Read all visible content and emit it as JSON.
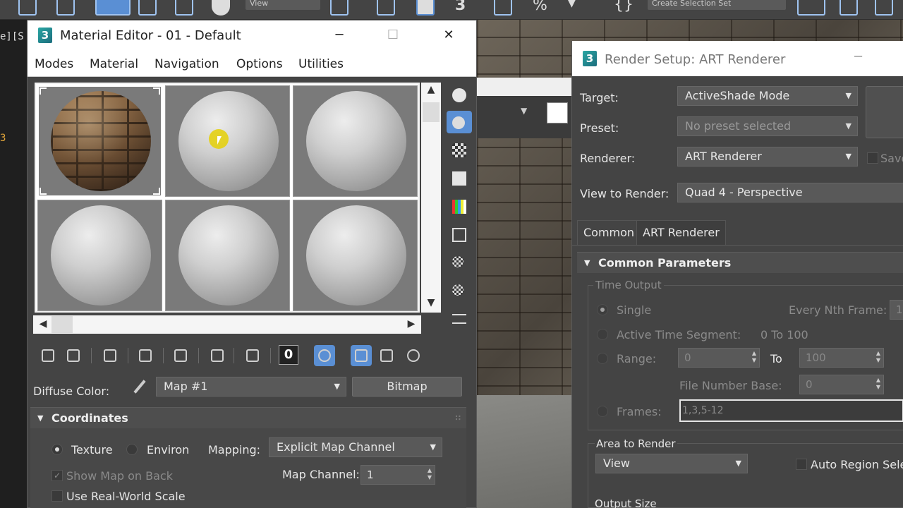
{
  "background": {
    "toolbar_dropdown_1": "View",
    "toolbar_dropdown_2": "Create Selection Set",
    "left_code_1": "e][S",
    "left_code_2": "3"
  },
  "material_editor": {
    "title": "Material Editor - 01 - Default",
    "menu": [
      "Modes",
      "Material",
      "Navigation",
      "Options",
      "Utilities"
    ],
    "diffuse_label": "Diffuse Color:",
    "map_value": "Map #1",
    "map_type_button": "Bitmap",
    "rollout_coordinates": "Coordinates",
    "texture_label": "Texture",
    "environ_label": "Environ",
    "mapping_label": "Mapping:",
    "mapping_value": "Explicit Map Channel",
    "show_map_on_back": "Show Map on Back",
    "map_channel_label": "Map Channel:",
    "map_channel_value": "1",
    "use_real_world_scale": "Use Real-World Scale",
    "zero_button": "0",
    "selected_slot": 1
  },
  "render_setup": {
    "title": "Render Setup: ART Renderer",
    "target_label": "Target:",
    "target_value": "ActiveShade Mode",
    "preset_label": "Preset:",
    "preset_value": "No preset selected",
    "renderer_label": "Renderer:",
    "renderer_value": "ART Renderer",
    "save_label": "Save",
    "view_label": "View to Render:",
    "view_value": "Quad 4 - Perspective",
    "tabs": [
      "Common",
      "ART Renderer"
    ],
    "rollout_common": "Common Parameters",
    "time_output": "Time Output",
    "single": "Single",
    "every_nth": "Every Nth Frame:",
    "every_nth_value": "1",
    "active_segment": "Active Time Segment:",
    "active_segment_value": "0 To 100",
    "range": "Range:",
    "range_from": "0",
    "range_to_label": "To",
    "range_to": "100",
    "file_number_base": "File Number Base:",
    "file_number_base_value": "0",
    "frames": "Frames:",
    "frames_value": "1,3,5-12",
    "area_to_render": "Area to Render",
    "area_value": "View",
    "auto_region": "Auto Region Sele",
    "output_size": "Output Size"
  },
  "colors": {
    "accent_blue": "#5a8fd4",
    "cursor_highlight": "#e4d012",
    "panel_bg": "#444444"
  }
}
